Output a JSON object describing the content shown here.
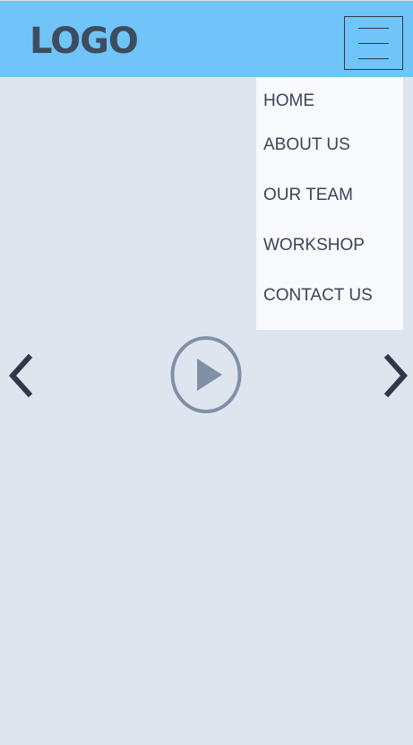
{
  "header": {
    "logo_text": "LOGO",
    "background_color": "#70c4f7",
    "menu_icon": "hamburger-menu-icon"
  },
  "nav_menu": {
    "items": [
      {
        "label": "HOME"
      },
      {
        "label": "ABOUT US"
      },
      {
        "label": "OUR TEAM"
      },
      {
        "label": "WORKSHOP"
      },
      {
        "label": "CONTACT US"
      }
    ]
  },
  "slider": {
    "prev_icon": "chevron-left-icon",
    "next_icon": "chevron-right-icon",
    "play_icon": "play-circle-icon"
  },
  "colors": {
    "page_background": "#dfe5ee",
    "menu_background": "#f7f9fc",
    "text_dark": "#3a4556",
    "play_icon": "#8090a6"
  }
}
